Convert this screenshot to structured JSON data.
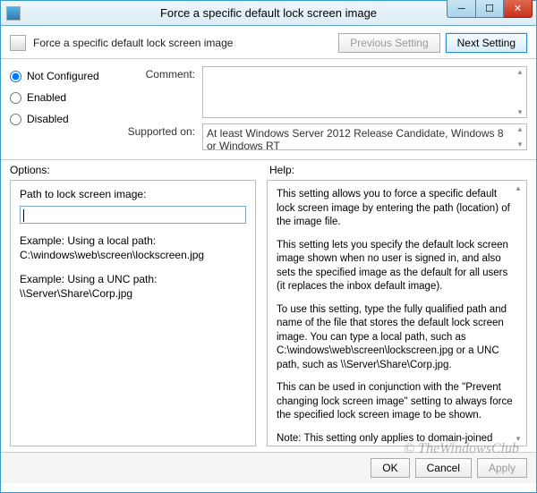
{
  "window": {
    "title": "Force a specific default lock screen image"
  },
  "header": {
    "title": "Force a specific default lock screen image",
    "prev_button": "Previous Setting",
    "next_button": "Next Setting"
  },
  "state": {
    "radios": {
      "not_configured": "Not Configured",
      "enabled": "Enabled",
      "disabled": "Disabled",
      "selected": "not_configured"
    },
    "comment_label": "Comment:",
    "comment_value": "",
    "supported_label": "Supported on:",
    "supported_value": "At least Windows Server 2012 Release Candidate, Windows 8 or Windows RT"
  },
  "sections": {
    "options_label": "Options:",
    "help_label": "Help:"
  },
  "options": {
    "path_label": "Path to lock screen image:",
    "path_value": "",
    "example1_title": "Example: Using a local path:",
    "example1_value": "C:\\windows\\web\\screen\\lockscreen.jpg",
    "example2_title": "Example: Using a UNC path:",
    "example2_value": "\\\\Server\\Share\\Corp.jpg"
  },
  "help": {
    "p1": "This setting allows you to force a specific default lock screen image by entering the path (location) of the image file.",
    "p2": "This setting lets you specify the default lock screen image shown when no user is signed in, and also sets the specified image as the default for all users (it replaces the inbox default image).",
    "p3": "To use this setting, type the fully qualified path and name of the file that stores the default lock screen image. You can type a local path, such as C:\\windows\\web\\screen\\lockscreen.jpg or a UNC path, such as \\\\Server\\Share\\Corp.jpg.",
    "p4": "This can be used in conjunction with the \"Prevent changing lock screen image\" setting to always force the specified lock screen image to be shown.",
    "p5": "Note: This setting only applies to domain-joined machines, or unconditionally in Enterprise and Server SKUs."
  },
  "footer": {
    "ok": "OK",
    "cancel": "Cancel",
    "apply": "Apply"
  },
  "watermark": "© TheWindowsClub"
}
